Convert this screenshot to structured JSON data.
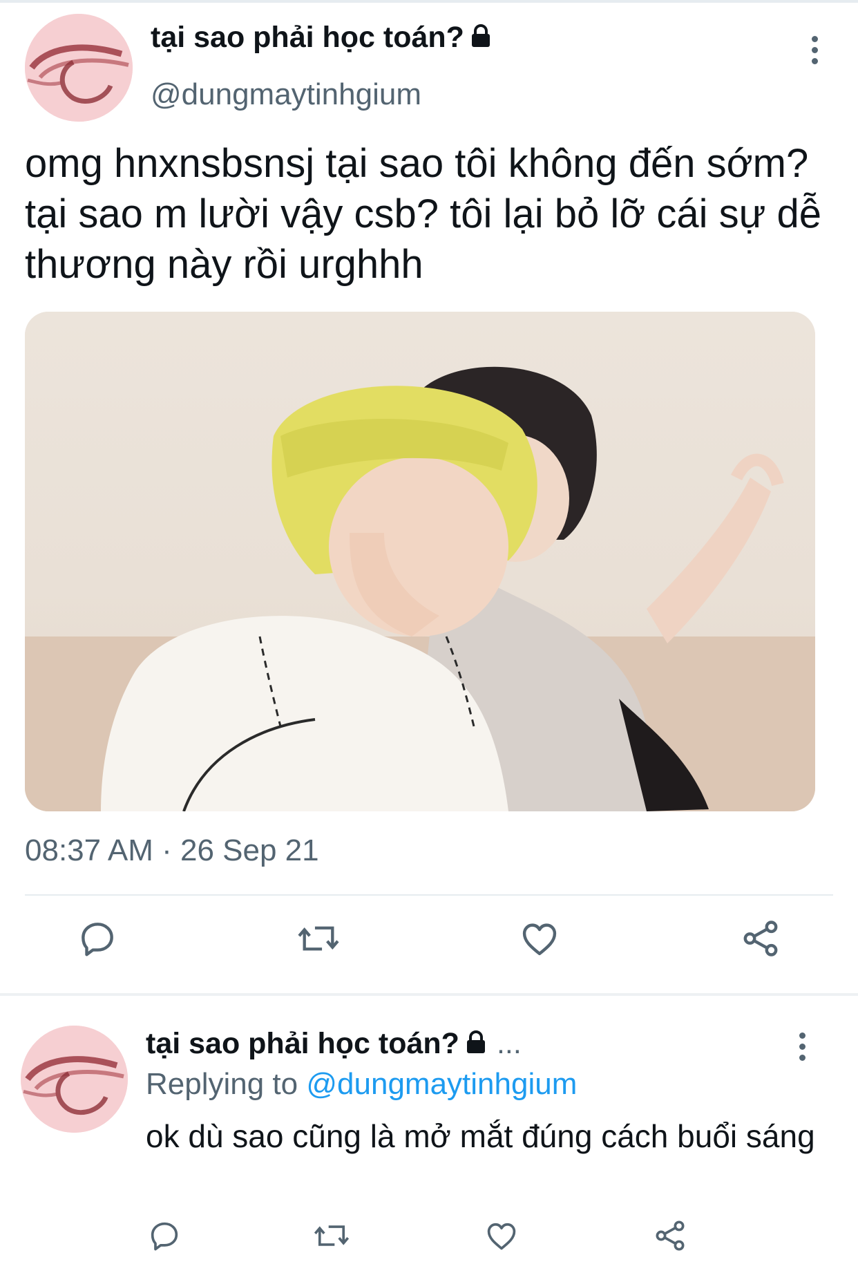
{
  "colors": {
    "accent": "#1d9bf0",
    "secondary_text": "#536471",
    "primary_text": "#0f1419",
    "avatar_bg": "#f6cfd2",
    "divider": "#e6ecf0"
  },
  "main_tweet": {
    "display_name": "tại sao phải học toán?",
    "handle": "@dungmaytinhgium",
    "protected_icon": "lock-icon",
    "text": "omg hnxnsbsnsj tại sao tôi không đến sớm? tại sao m lười vậy csb? tôi lại bỏ lỡ cái sự dễ thương này rồi urghhh",
    "media_icon": "photo",
    "timestamp": "08:37 AM · 26 Sep 21",
    "actions": [
      "reply-icon",
      "retweet-icon",
      "like-icon",
      "share-icon"
    ]
  },
  "reply_tweet": {
    "display_name": "tại sao phải học toán?",
    "ellipsis": "...",
    "replying_prefix": "Replying to",
    "replying_to": "@dungmaytinhgium",
    "text": "ok dù sao cũng là mở mắt đúng cách buổi sáng",
    "actions": [
      "reply-icon",
      "retweet-icon",
      "like-icon",
      "share-icon"
    ]
  }
}
